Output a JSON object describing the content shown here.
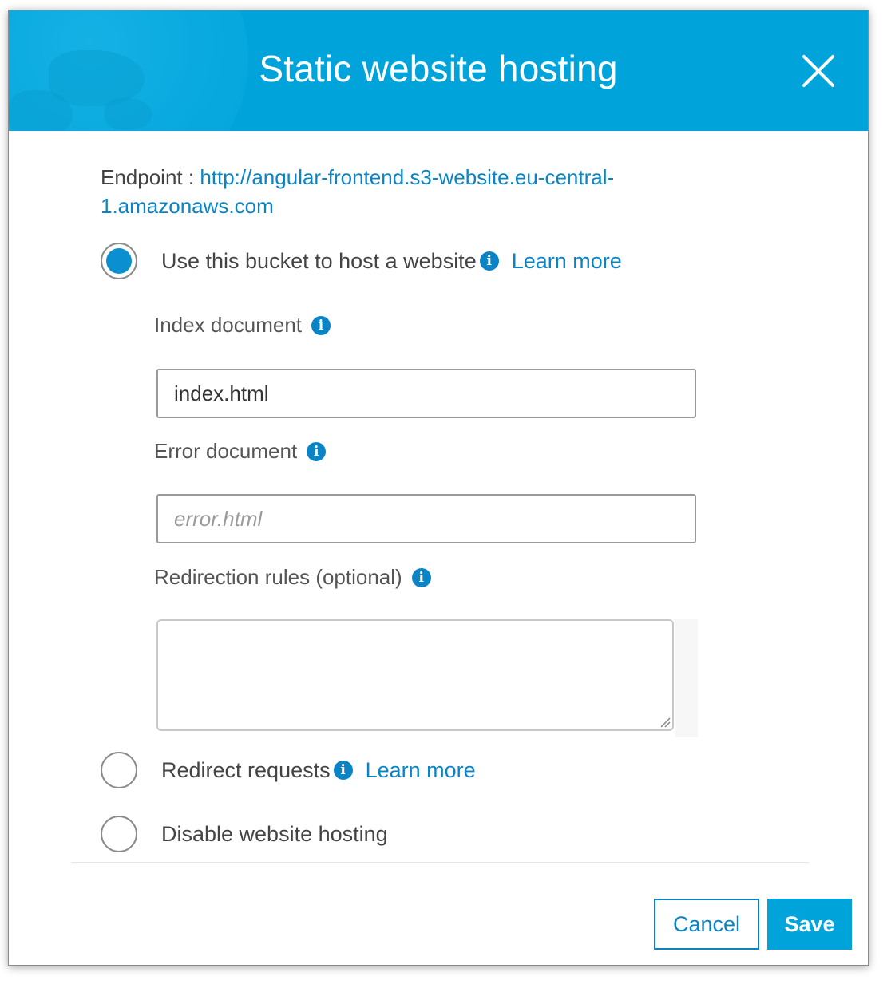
{
  "dialog": {
    "title": "Static website hosting",
    "close_icon": "close-icon"
  },
  "endpoint": {
    "label": "Endpoint : ",
    "url": "http://angular-frontend.s3-website.eu-central-1.amazonaws.com"
  },
  "options": {
    "host": {
      "label": "Use this bucket to host a website",
      "learn_more": "Learn more",
      "checked": true
    },
    "redirect": {
      "label": "Redirect requests",
      "learn_more": "Learn more",
      "checked": false
    },
    "disable": {
      "label": "Disable website hosting",
      "checked": false
    }
  },
  "fields": {
    "index_document": {
      "label": "Index document",
      "value": "index.html"
    },
    "error_document": {
      "label": "Error document",
      "placeholder": "error.html",
      "value": ""
    },
    "redirection_rules": {
      "label": "Redirection rules (optional)",
      "value": ""
    }
  },
  "info_glyph": "i",
  "buttons": {
    "cancel": "Cancel",
    "save": "Save"
  },
  "colors": {
    "header": "#00a4db",
    "link": "#0a84c4",
    "radio_selected": "#0a8fd1"
  }
}
